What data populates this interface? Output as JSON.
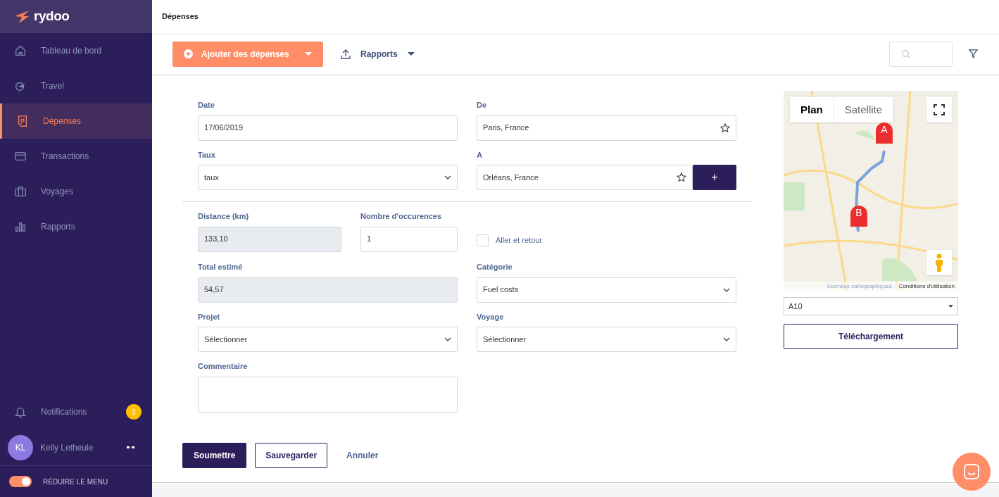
{
  "brand": {
    "name": "rydoo"
  },
  "sidebar": {
    "items": [
      {
        "label": "Tableau de bord",
        "selected": false
      },
      {
        "label": "Travel",
        "selected": false
      },
      {
        "label": "Dépenses",
        "selected": true
      },
      {
        "label": "Transactions",
        "selected": false
      },
      {
        "label": "Voyages",
        "selected": false
      },
      {
        "label": "Rapports",
        "selected": false
      }
    ],
    "notifications": {
      "label": "Notifications",
      "count": "3"
    },
    "user": {
      "initials": "KL",
      "name": "Kelly Letheule"
    },
    "collapse": {
      "label": "RÉDUIRE LE MENU",
      "on": true
    }
  },
  "header": {
    "title": "Dépenses"
  },
  "toolbar": {
    "add_button": "Ajouter des dépenses",
    "reports_button": "Rapports"
  },
  "form": {
    "rows": [
      {
        "cells": [
          {
            "kind": "text",
            "label": "Date",
            "value": "17/06/2019"
          },
          {
            "kind": "star",
            "label": "De",
            "value": "Paris, France"
          }
        ]
      },
      {
        "cells": [
          {
            "kind": "select",
            "label": "Taux",
            "value": "taux"
          },
          {
            "kind": "staradd",
            "label": "A",
            "value": "Orléans, France",
            "button": "+"
          }
        ]
      },
      {
        "cells": [
          {
            "kind": "readonly",
            "label": "Distance (km)",
            "value": "133,10"
          },
          {
            "kind": "text",
            "label": "Nombre d'occurences",
            "value": "1"
          },
          {
            "kind": "checkbox",
            "label": "Aller et retour",
            "checked": false
          }
        ]
      },
      {
        "cells": [
          {
            "kind": "readonly",
            "label": "Total estimé",
            "value": "54,57"
          },
          {
            "kind": "select",
            "label": "Catégorie",
            "value": "Fuel costs"
          }
        ]
      },
      {
        "cells": [
          {
            "kind": "select",
            "label": "Projet",
            "value": "Sélectionner"
          },
          {
            "kind": "select",
            "label": "Voyage",
            "value": "Sélectionner"
          }
        ]
      },
      {
        "cells": [
          {
            "kind": "textarea",
            "label": "Commentaire"
          }
        ]
      }
    ],
    "actions": [
      {
        "kind": "primary",
        "label": "Soumettre"
      },
      {
        "kind": "outline",
        "label": "Sauvegarder"
      },
      {
        "kind": "link",
        "label": "Annuler"
      }
    ]
  },
  "map": {
    "tabs": [
      {
        "label": "Plan",
        "selected": true
      },
      {
        "label": "Satellite",
        "selected": false
      }
    ],
    "markers": [
      "A",
      "B"
    ],
    "attribution": "Données cartographiques",
    "terms": "Conditions d'utilisation",
    "route_select": "A10",
    "download_button": "Téléchargement"
  }
}
